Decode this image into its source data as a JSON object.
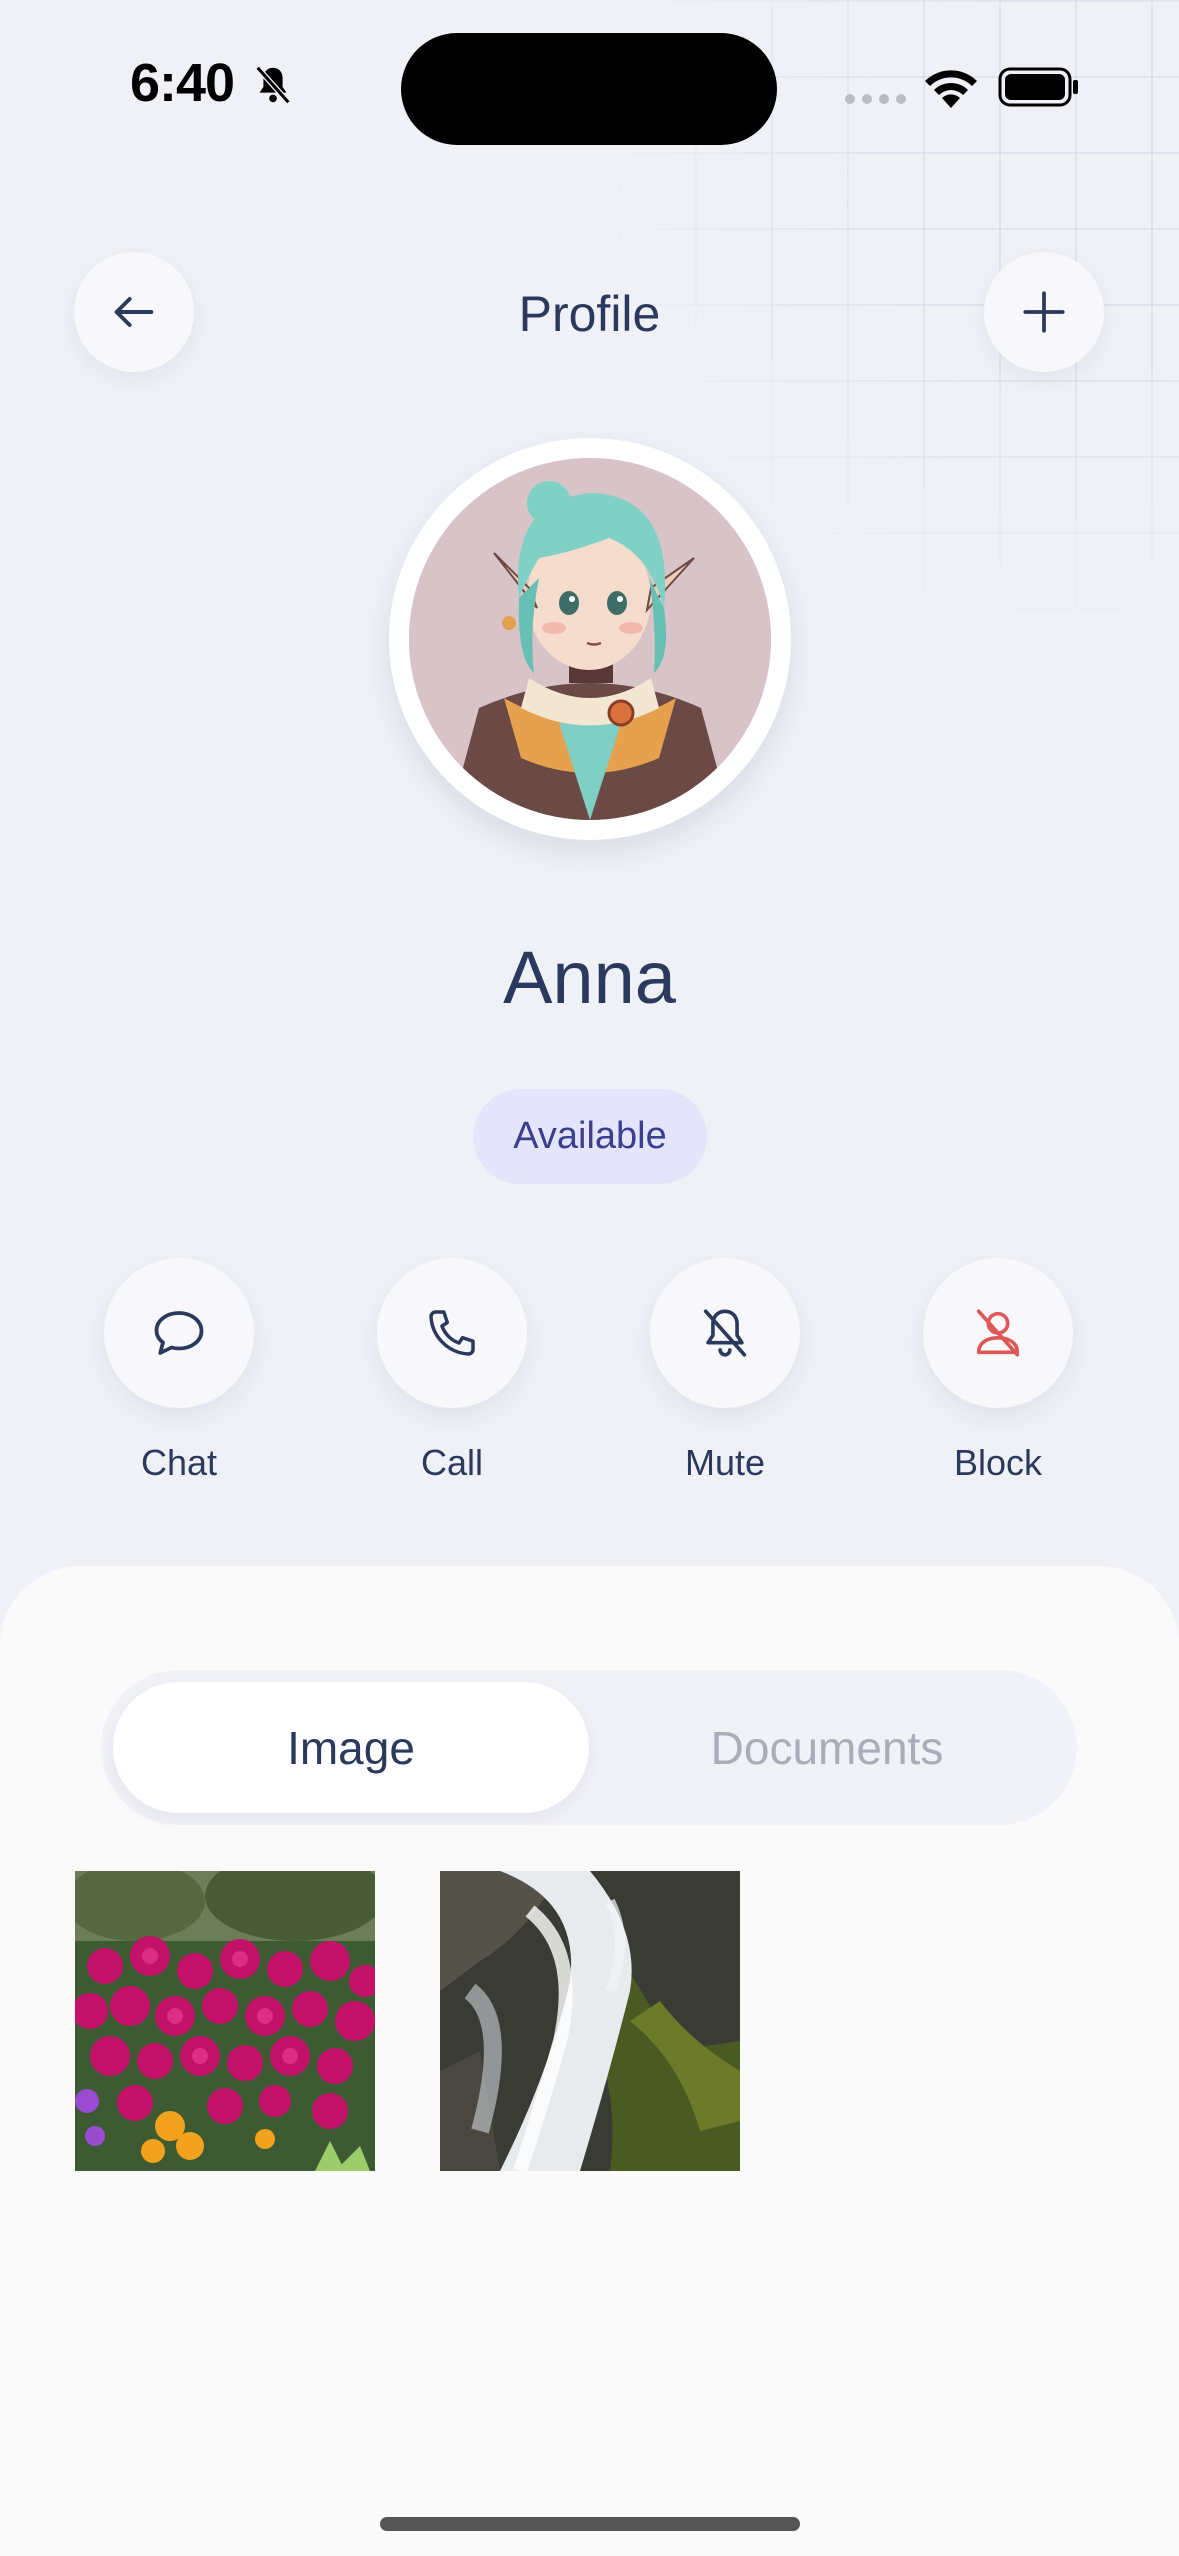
{
  "status_bar": {
    "time": "6:40"
  },
  "header": {
    "title": "Profile",
    "back_icon": "arrow-left-icon",
    "add_icon": "plus-icon"
  },
  "profile": {
    "name": "Anna",
    "status": "Available"
  },
  "actions": [
    {
      "label": "Chat",
      "icon": "chat-bubble-icon",
      "color": "#2b3a5c"
    },
    {
      "label": "Call",
      "icon": "phone-icon",
      "color": "#2b3a5c"
    },
    {
      "label": "Mute",
      "icon": "bell-off-icon",
      "color": "#2b3a5c"
    },
    {
      "label": "Block",
      "icon": "user-blocked-icon",
      "color": "#e05757"
    }
  ],
  "tabs": {
    "active": "Image",
    "inactive": "Documents"
  },
  "media": [
    "flowers-photo",
    "waterfall-photo"
  ],
  "colors": {
    "accent": "#2b3a5c",
    "badge_bg": "#e4e4fb",
    "badge_text": "#3a3f8f",
    "danger": "#e05757"
  }
}
